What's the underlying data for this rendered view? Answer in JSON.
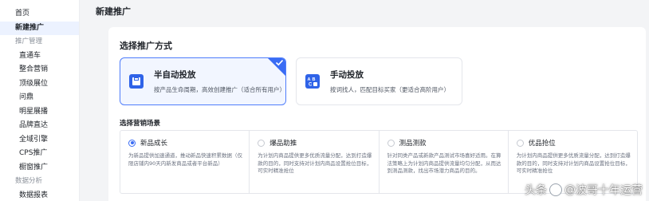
{
  "sidebar": {
    "items": [
      {
        "label": "首页",
        "type": "item"
      },
      {
        "label": "新建推广",
        "type": "item",
        "active": true
      },
      {
        "label": "推广管理",
        "type": "group"
      },
      {
        "label": "直通车",
        "type": "sub"
      },
      {
        "label": "整合营销",
        "type": "sub"
      },
      {
        "label": "顶级展位",
        "type": "sub"
      },
      {
        "label": "问鼎",
        "type": "sub"
      },
      {
        "label": "明星展播",
        "type": "sub"
      },
      {
        "label": "品牌直达",
        "type": "sub"
      },
      {
        "label": "全域引擎",
        "type": "sub"
      },
      {
        "label": "CPS推广",
        "type": "sub"
      },
      {
        "label": "橱窗推广",
        "type": "sub"
      },
      {
        "label": "数据分析",
        "type": "group"
      },
      {
        "label": "数据报表",
        "type": "sub"
      }
    ]
  },
  "main": {
    "title": "新建推广",
    "section_title": "选择推广方式",
    "modes": [
      {
        "name": "半自动投放",
        "desc": "按产品生命周期，高效创建推广（适合所有用户）",
        "icon": "box-icon",
        "selected": true
      },
      {
        "name": "手动投放",
        "desc": "按词找人，匹配目标买家（更适合高阶用户）",
        "icon": "abc-icon",
        "selected": false
      }
    ],
    "goal_title": "选择营销场景",
    "goals": [
      {
        "name": "新品成长",
        "checked": true,
        "desc": "为新品提供加速通道，推动新品快速积累数据（仅限店铺内90天内新发商品或者平台新品）"
      },
      {
        "name": "爆品助推",
        "checked": false,
        "desc": "为计划内商品提供更多优质流量分配，达到打造爆款的目的，同时支持对计划内商品设置抢位目标，可实时精准抢位"
      },
      {
        "name": "测品测款",
        "checked": false,
        "desc": "针对同类产品或新款产品测试市场喜好适用。在算法策略上为计划内商品提供流量均匀分配，从而达到测品测款，找出市场潜力商品的目的。"
      },
      {
        "name": "优品抢位",
        "checked": false,
        "desc": "为计划内商品提供更多优质流量分配，达到打造爆款的目的，同时支持对计划内商品设置抢位目标，可实时精准抢位"
      }
    ]
  },
  "watermark": {
    "prefix": "头条",
    "at": "@",
    "text": "波哥十年运营"
  },
  "colors": {
    "accent": "#3a6cf4",
    "selected_bg": "#f2f6ff",
    "sidebar_active_bg": "#ecf2ff",
    "page_bg": "#f3f4f6"
  }
}
